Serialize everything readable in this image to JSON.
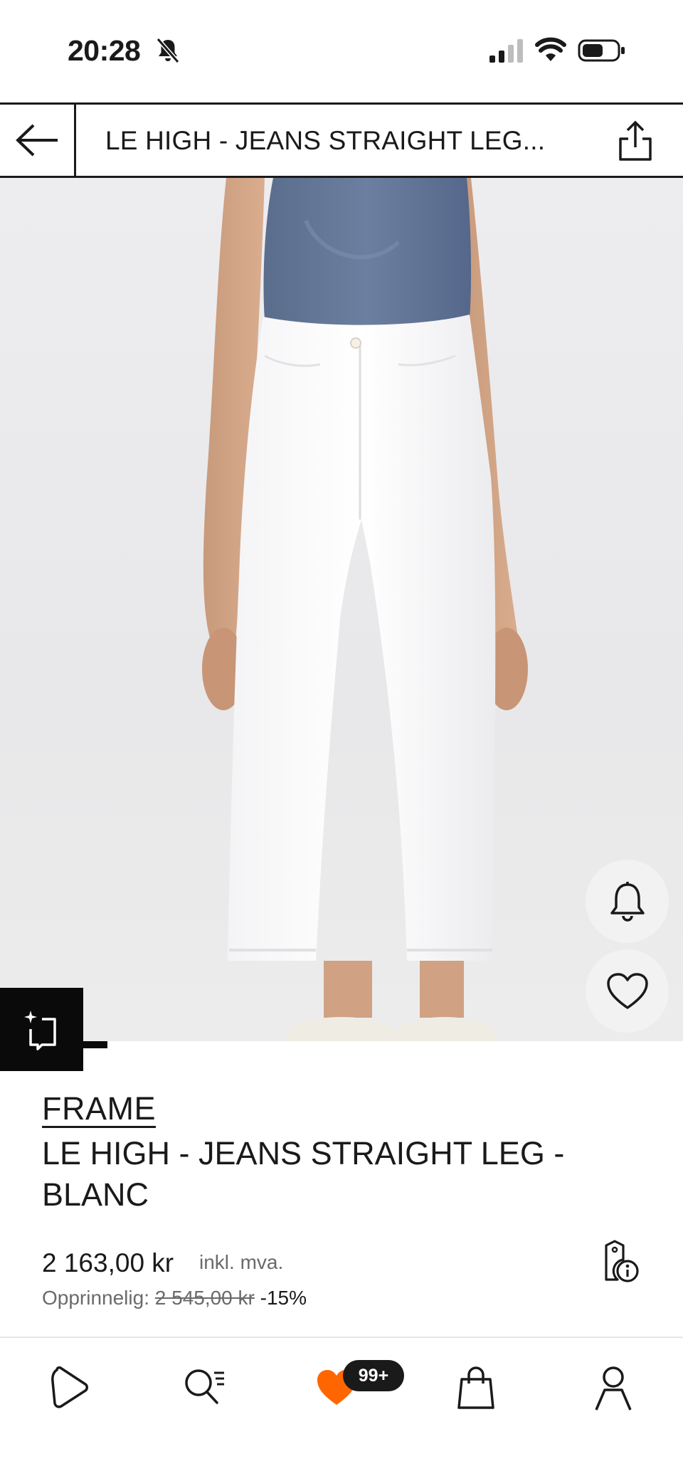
{
  "status_bar": {
    "time": "20:28"
  },
  "header": {
    "title": "LE HIGH - JEANS STRAIGHT LEG..."
  },
  "product": {
    "brand": "FRAME",
    "name": "LE HIGH - JEANS STRAIGHT LEG - BLANC",
    "price": "2 163,00 kr",
    "tax_note": "inkl. mva.",
    "original_label": "Opprinnelig:",
    "original_price": "2 545,00 kr",
    "discount": "-15%"
  },
  "gallery": {
    "progress": 0.04
  },
  "tabbar": {
    "wishlist_badge": "99+"
  },
  "colors": {
    "accent": "#ff6600",
    "text": "#1a1a1a",
    "muted": "#6a6a6a",
    "jeans": "#ffffff",
    "top": "#5c6f8e"
  },
  "icons": [
    "back-arrow-icon",
    "share-icon",
    "bell-icon",
    "heart-icon",
    "ar-tryon-icon",
    "price-info-icon",
    "home-icon",
    "search-icon",
    "wishlist-heart-icon",
    "bag-icon",
    "profile-icon"
  ]
}
